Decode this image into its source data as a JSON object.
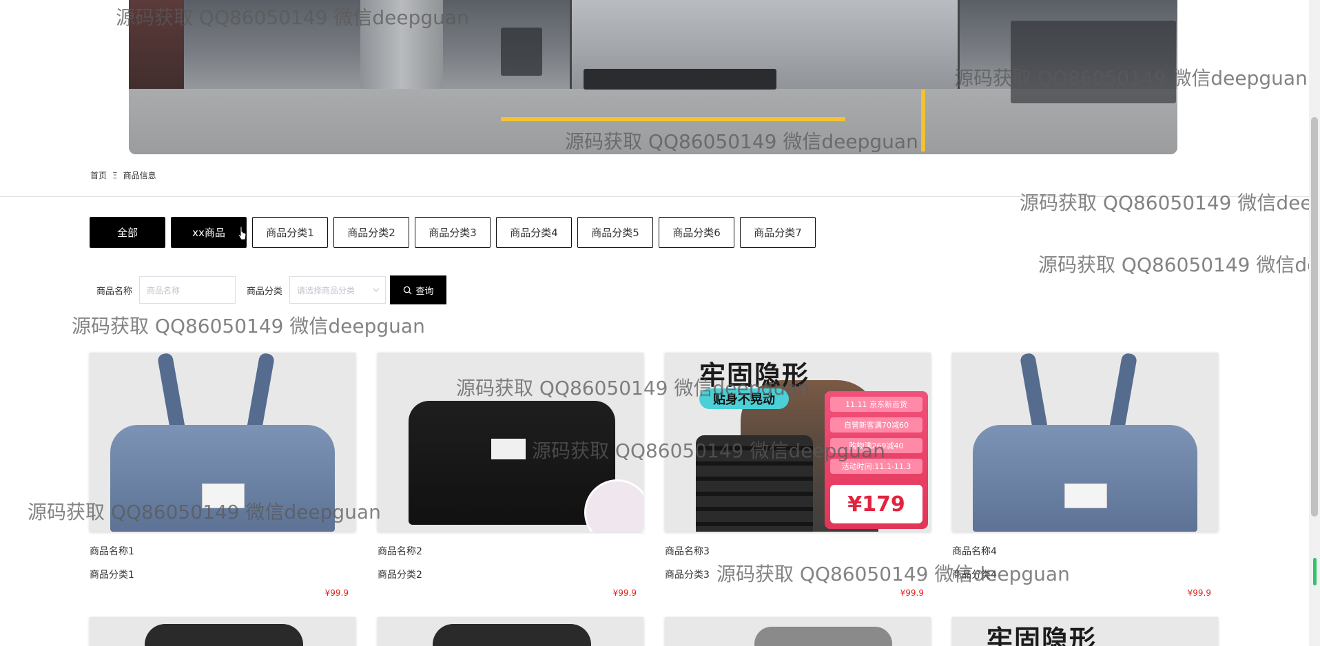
{
  "breadcrumb": {
    "home": "首页",
    "separator": "Ξ",
    "current": "商品信息"
  },
  "categories": [
    {
      "label": "全部",
      "active": true
    },
    {
      "label": "xx商品",
      "active": true
    },
    {
      "label": "商品分类1",
      "active": false
    },
    {
      "label": "商品分类2",
      "active": false
    },
    {
      "label": "商品分类3",
      "active": false
    },
    {
      "label": "商品分类4",
      "active": false
    },
    {
      "label": "商品分类5",
      "active": false
    },
    {
      "label": "商品分类6",
      "active": false
    },
    {
      "label": "商品分类7",
      "active": false
    }
  ],
  "search": {
    "name_label": "商品名称",
    "name_placeholder": "商品名称",
    "category_label": "商品分类",
    "category_placeholder": "请选择商品分类",
    "query_label": "查询"
  },
  "products": [
    {
      "name": "商品名称1",
      "category": "商品分类1",
      "price": "¥99.9",
      "image": "blue-travel-bag"
    },
    {
      "name": "商品名称2",
      "category": "商品分类2",
      "price": "¥99.9",
      "image": "black-travel-bag"
    },
    {
      "name": "商品名称3",
      "category": "商品分类3",
      "price": "¥99.9",
      "image": "weight-vest-promo"
    },
    {
      "name": "商品名称4",
      "category": "商品分类4",
      "price": "¥99.9",
      "image": "blue-travel-bag"
    }
  ],
  "vest_promo": {
    "title": "牢固隐形",
    "pill": "贴身不晃动",
    "rows": [
      "11.11 京东新百货",
      "自营新客满70减60",
      "购物满269减40",
      "活动时间:11.1-11.3"
    ],
    "price": "¥179"
  },
  "watermark": "源码获取 QQ86050149 微信deepguan",
  "colors": {
    "accent_black": "#000000",
    "price_red": "#e2231a",
    "scroll_green": "#31c46a"
  }
}
